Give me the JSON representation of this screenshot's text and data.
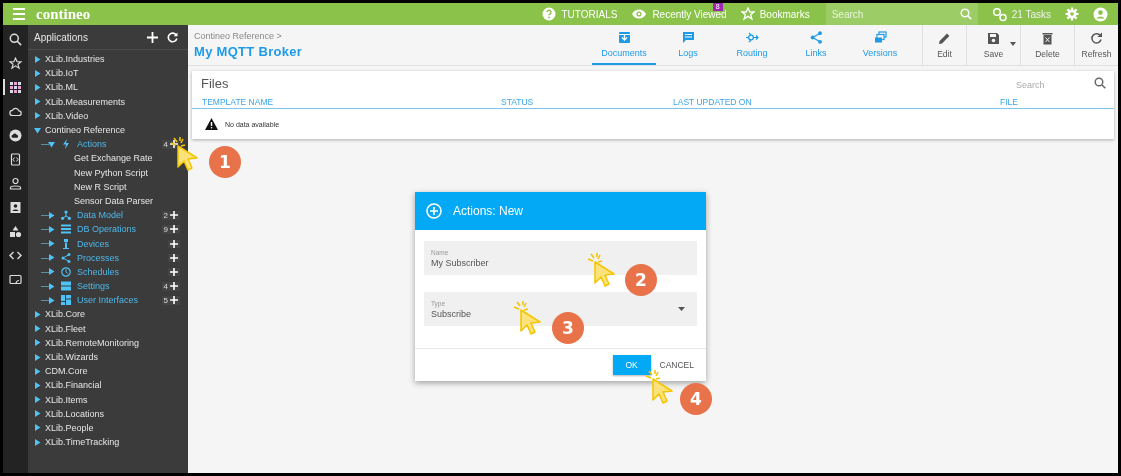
{
  "top_bar": {
    "logo": "contineo",
    "links": [
      {
        "kind": "help",
        "label": "TUTORIALS"
      },
      {
        "kind": "recent",
        "label": "Recently Viewed",
        "badge": "8"
      },
      {
        "kind": "bookmarks",
        "label": "Bookmarks"
      }
    ],
    "search": {
      "placeholder": "Search"
    },
    "tasks": "21 Tasks"
  },
  "rail": [
    {
      "selected": false
    },
    {
      "selected": false
    },
    {
      "selected": true
    },
    {
      "selected": false
    },
    {
      "selected": false
    },
    {
      "selected": false
    },
    {
      "selected": false
    },
    {
      "selected": false
    },
    {
      "selected": false
    },
    {
      "selected": false
    },
    {
      "selected": false
    }
  ],
  "sidebar": {
    "title": "Applications",
    "tree": [
      {
        "label": "XLib.Industries",
        "expanded": false
      },
      {
        "label": "XLib.IoT",
        "expanded": false
      },
      {
        "label": "XLib.ML",
        "expanded": false
      },
      {
        "label": "XLib.Measurements",
        "expanded": false
      },
      {
        "label": "XLib.Video",
        "expanded": false
      },
      {
        "label": "Contineo Reference",
        "expanded": true,
        "children": [
          {
            "label": "Actions",
            "expanded": true,
            "count": "4",
            "children": [
              {
                "label": "Get Exchange Rate"
              },
              {
                "label": "New Python Script"
              },
              {
                "label": "New R Script"
              },
              {
                "label": "Sensor Data Parser"
              }
            ]
          },
          {
            "label": "Data Model",
            "expanded": false,
            "count": "2"
          },
          {
            "label": "DB Operations",
            "expanded": false,
            "count": "9"
          },
          {
            "label": "Devices",
            "expanded": false
          },
          {
            "label": "Processes",
            "expanded": false
          },
          {
            "label": "Schedules",
            "expanded": false
          },
          {
            "label": "Settings",
            "expanded": false,
            "count": "4"
          },
          {
            "label": "User Interfaces",
            "expanded": false,
            "count": "5"
          }
        ]
      },
      {
        "label": "XLib.Core",
        "expanded": false
      },
      {
        "label": "XLib.Fleet",
        "expanded": false
      },
      {
        "label": "XLib.RemoteMonitoring",
        "expanded": false
      },
      {
        "label": "XLib.Wizards",
        "expanded": false
      },
      {
        "label": "CDM.Core",
        "expanded": false
      },
      {
        "label": "XLib.Financial",
        "expanded": false
      },
      {
        "label": "XLib.Items",
        "expanded": false
      },
      {
        "label": "XLib.Locations",
        "expanded": false
      },
      {
        "label": "XLib.People",
        "expanded": false
      },
      {
        "label": "XLib.TimeTracking",
        "expanded": false
      }
    ]
  },
  "header": {
    "breadcrumb": "Contineo Reference >",
    "title": "My MQTT Broker",
    "tabs": [
      {
        "label": "Documents",
        "selected": true
      },
      {
        "label": "Logs",
        "selected": false
      },
      {
        "label": "Routing",
        "selected": false
      },
      {
        "label": "Links",
        "selected": false
      },
      {
        "label": "Versions",
        "selected": false
      }
    ],
    "actions": [
      {
        "label": "Edit"
      },
      {
        "label": "Save"
      },
      {
        "label": "Delete"
      },
      {
        "label": "Refresh"
      }
    ]
  },
  "files": {
    "title": "Files",
    "search_placeholder": "Search",
    "columns": [
      "TEMPLATE NAME",
      "STATUS",
      "LAST UPDATED ON",
      "FILE"
    ],
    "empty_message": "No data available"
  },
  "dialog": {
    "title": "Actions: New",
    "fields": [
      {
        "kind": "text",
        "label": "Name",
        "value": "My Subscriber"
      },
      {
        "kind": "select",
        "label": "Type",
        "value": "Subscribe"
      }
    ],
    "buttons": [
      {
        "kind": "primary",
        "label": "OK"
      },
      {
        "kind": "flat",
        "label": "CANCEL"
      }
    ]
  },
  "callouts": [
    {
      "label": "1"
    },
    {
      "label": "2"
    },
    {
      "label": "3"
    },
    {
      "label": "4"
    }
  ]
}
